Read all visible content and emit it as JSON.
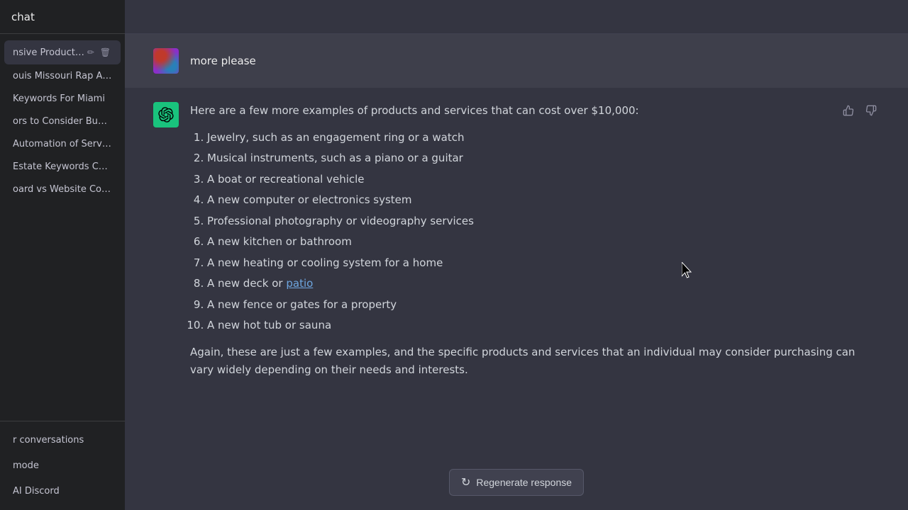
{
  "sidebar": {
    "chat_label": "chat",
    "items": [
      {
        "id": "item-1",
        "label": "nsive Products an",
        "active": true
      },
      {
        "id": "item-2",
        "label": "ouis Missouri Rap Artists"
      },
      {
        "id": "item-3",
        "label": "Keywords For Miami"
      },
      {
        "id": "item-4",
        "label": "ors to Consider Buying S"
      },
      {
        "id": "item-5",
        "label": "Automation of Services"
      },
      {
        "id": "item-6",
        "label": "Estate Keywords Chicag"
      },
      {
        "id": "item-7",
        "label": "oard vs Website Compar"
      }
    ],
    "bottom_items": [
      {
        "id": "clear",
        "label": "r conversations"
      },
      {
        "id": "mode",
        "label": "mode"
      },
      {
        "id": "discord",
        "label": "AI Discord"
      }
    ]
  },
  "user_message": {
    "text": "more please"
  },
  "ai_message": {
    "intro": "Here are a few more examples of products and services that can cost over $10,000:",
    "list_items": [
      "Jewelry, such as an engagement ring or a watch",
      "Musical instruments, such as a piano or a guitar",
      "A boat or recreational vehicle",
      "A new computer or electronics system",
      "Professional photography or videography services",
      "A new kitchen or bathroom",
      "A new heating or cooling system for a home",
      "A new deck or patio",
      "A new fence or gates for a property",
      "A new hot tub or sauna"
    ],
    "list_item_8_link_text": "patio",
    "outro": "Again, these are just a few examples, and the specific products and services that an individual may consider purchasing can vary widely depending on their needs and interests."
  },
  "bottom": {
    "regenerate_label": "Regenerate response",
    "regenerate_icon": "↻"
  },
  "icons": {
    "thumbs_up": "👍",
    "thumbs_down": "👎",
    "edit": "✏",
    "trash": "🗑"
  }
}
